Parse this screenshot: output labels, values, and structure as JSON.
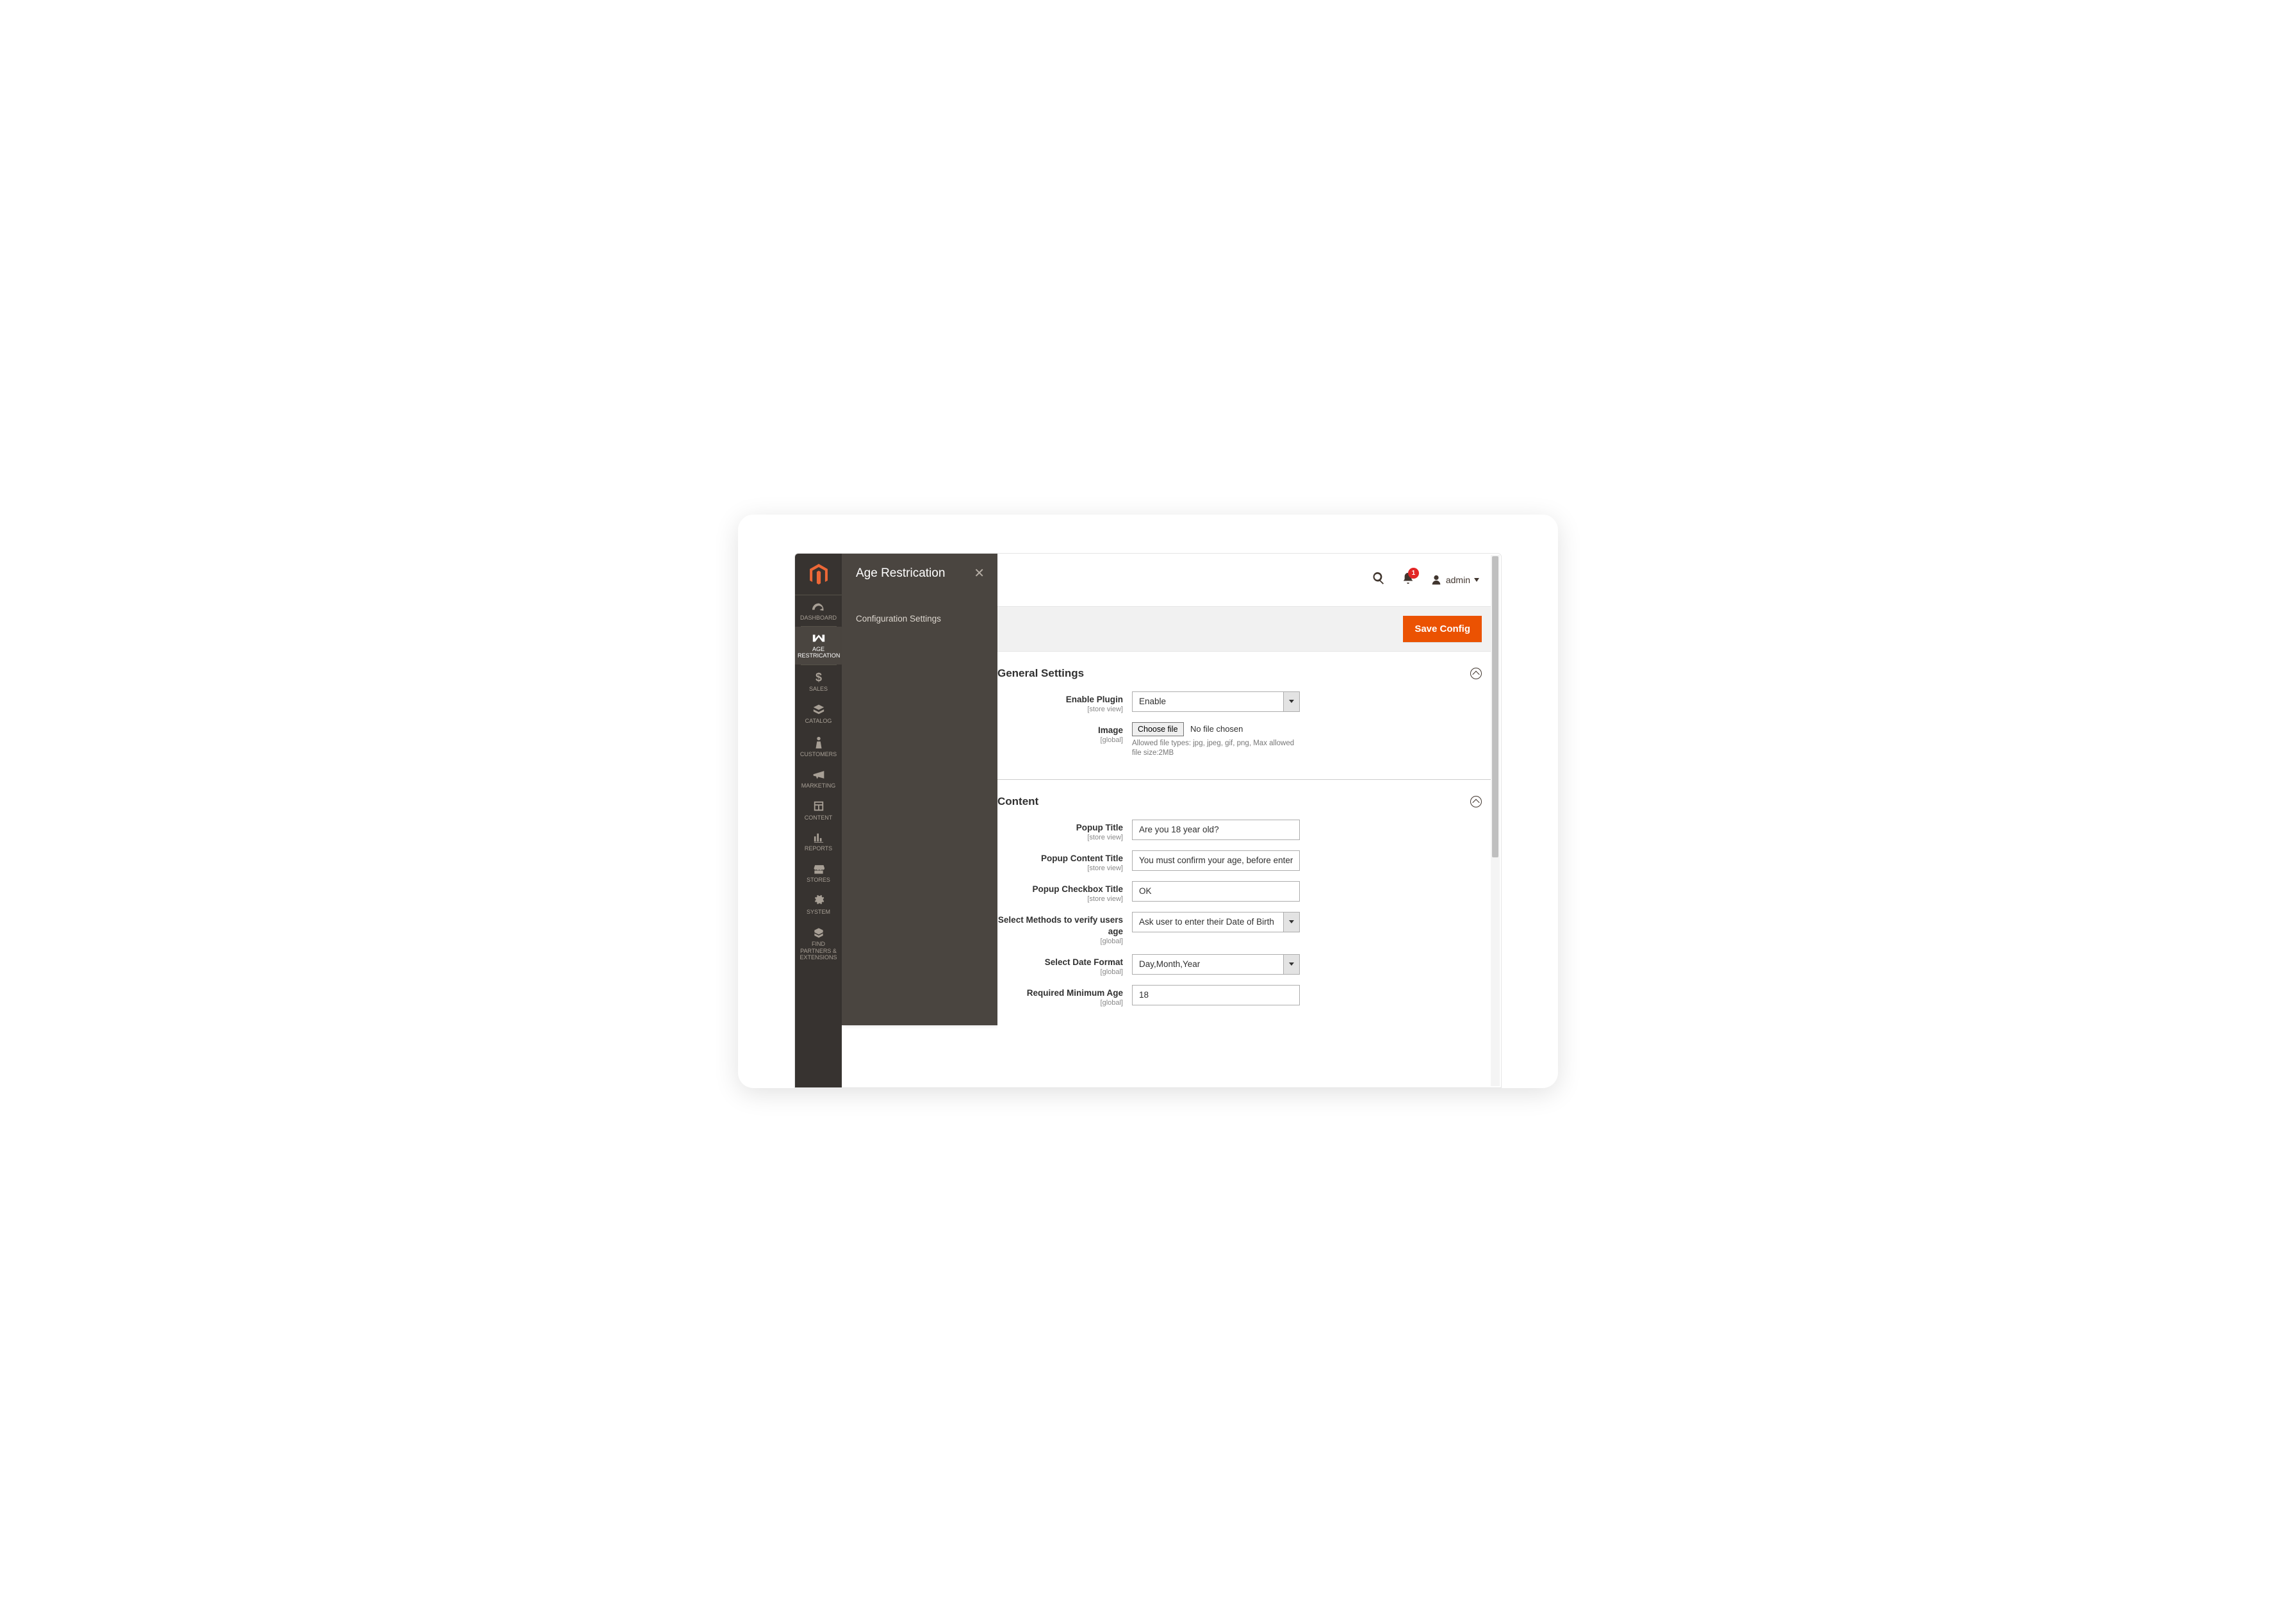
{
  "submenu": {
    "title": "Age Restrication",
    "item": "Configuration Settings"
  },
  "sidebar": {
    "dashboard": "Dashboard",
    "age": "Age Restrication",
    "sales": "Sales",
    "catalog": "Catalog",
    "customers": "Customers",
    "marketing": "Marketing",
    "content": "Content",
    "reports": "Reports",
    "stores": "Stores",
    "system": "System",
    "partners": "Find Partners & Extensions"
  },
  "topbar": {
    "notifications": "1",
    "user": "admin"
  },
  "actions": {
    "save": "Save Config"
  },
  "sections": {
    "general": {
      "title": "General Settings",
      "enable": {
        "label": "Enable Plugin",
        "scope": "[store view]",
        "value": "Enable"
      },
      "image": {
        "label": "Image",
        "scope": "[global]",
        "button": "Choose file",
        "status": "No file chosen",
        "hint": "Allowed file types: jpg, jpeg, gif, png, Max allowed file size:2MB"
      }
    },
    "content": {
      "title": "Content",
      "popup_title": {
        "label": "Popup Title",
        "scope": "[store view]",
        "value": "Are you 18 year old?"
      },
      "popup_content_title": {
        "label": "Popup Content Title",
        "scope": "[store view]",
        "value": "You must confirm your age, before entering"
      },
      "popup_checkbox_title": {
        "label": "Popup Checkbox Title",
        "scope": "[store view]",
        "value": "OK"
      },
      "verify_method": {
        "label": "Select Methods to verify users age",
        "scope": "[global]",
        "value": "Ask user to enter their Date of Birth"
      },
      "date_format": {
        "label": "Select Date Format",
        "scope": "[global]",
        "value": "Day,Month,Year"
      },
      "min_age": {
        "label": "Required Minimum Age",
        "scope": "[global]",
        "value": "18"
      }
    }
  }
}
